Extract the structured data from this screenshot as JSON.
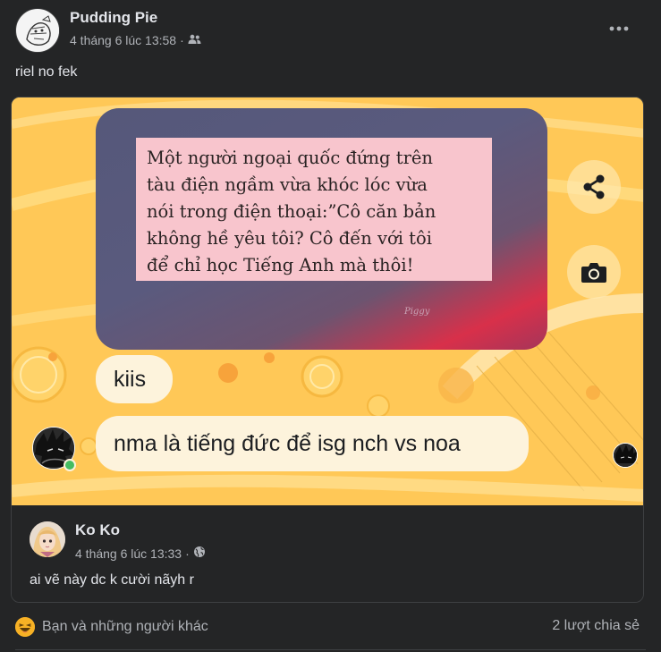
{
  "post": {
    "author": "Pudding Pie",
    "timestamp": "4 tháng 6 lúc 13:58",
    "separator": "·",
    "audience_icon": "friends-icon",
    "more_icon": "more-horizontal-icon",
    "caption": "riel no fek"
  },
  "image": {
    "quote_lines": [
      "Một người ngoại quốc đứng trên",
      "tàu điện ngầm vừa khóc lóc vừa",
      "nói trong điện thoại:”Cô căn bản",
      "không hề yêu tôi? Cô đến với tôi",
      "để chỉ học Tiếng Anh mà thôi!"
    ],
    "signature": "Piggy",
    "bubble_1": "kiis",
    "bubble_2": "nma là tiếng đức để isg nch vs noa",
    "share_icon": "share-icon",
    "camera_icon": "camera-icon"
  },
  "comment": {
    "author": "Ko Ko",
    "timestamp": "4 tháng 6 lúc 13:33",
    "separator": "·",
    "audience_icon": "globe-icon",
    "text": "ai vẽ này dc k cười nãyh r"
  },
  "footer": {
    "reaction_icon": "haha-reaction-icon",
    "reactions_text": "Bạn và những người khác",
    "shares_text": "2 lượt chia sẻ"
  },
  "colors": {
    "background": "#242526",
    "text_primary": "#e4e6eb",
    "text_secondary": "#b0b3b8",
    "image_bg": "#ffc857",
    "bubble": "#fdf3dc",
    "quote_paper": "#f8c5cd",
    "online": "#45bd62",
    "reaction": "#f7b125"
  }
}
